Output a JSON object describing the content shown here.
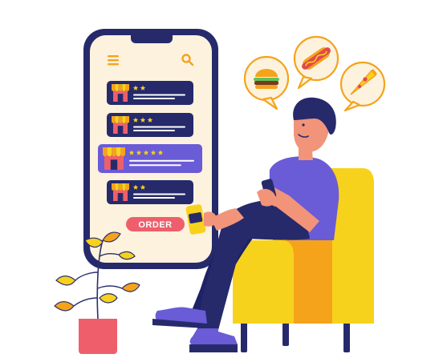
{
  "phone": {
    "order_button_label": "ORDER",
    "menu_icon": "hamburger-menu-icon",
    "search_icon": "search-icon",
    "restaurants": [
      {
        "stars": 2,
        "selected": false
      },
      {
        "stars": 3,
        "selected": false
      },
      {
        "stars": 5,
        "selected": true
      },
      {
        "stars": 2,
        "selected": false
      }
    ]
  },
  "thought_bubbles": [
    {
      "food": "burger-icon"
    },
    {
      "food": "hotdog-icon"
    },
    {
      "food": "pizza-slice-icon"
    }
  ],
  "colors": {
    "navy": "#262a6b",
    "purple": "#6a5bd6",
    "yellow": "#f7d21c",
    "orange": "#f5a31b",
    "pink": "#ee5f6b",
    "cream": "#fdf2dd",
    "skin": "#f2947a"
  }
}
